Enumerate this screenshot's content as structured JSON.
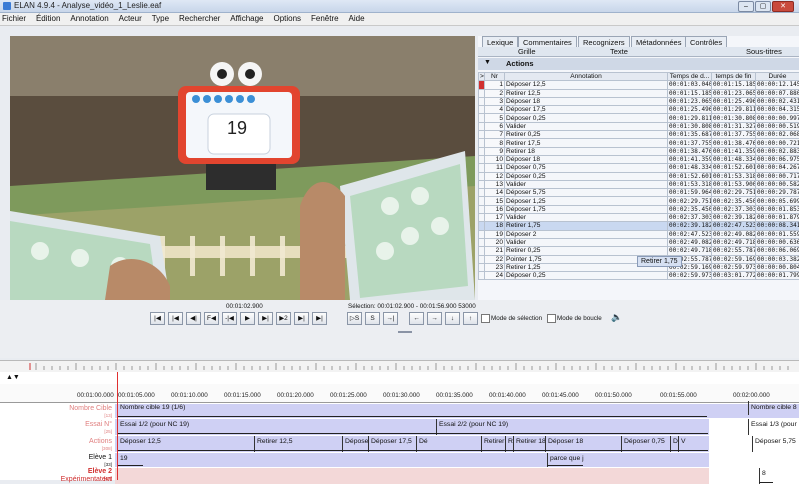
{
  "window": {
    "title": "ELAN 4.9.4 - Analyse_vidéo_1_Leslie.eaf",
    "controls": [
      "–",
      "▢",
      "✕"
    ]
  },
  "menu": [
    "Fichier",
    "Édition",
    "Annotation",
    "Acteur",
    "Type",
    "Rechercher",
    "Affichage",
    "Options",
    "Fenêtre",
    "Aide"
  ],
  "video": {
    "display_number": "19"
  },
  "tabs": [
    "Lexique",
    "Commentaires",
    "Recognizers",
    "Métadonnées",
    "Contrôles"
  ],
  "subtabs": [
    "Grille",
    "Texte",
    "Sous-titres"
  ],
  "grid": {
    "tier": "Actions",
    "columns": [
      "Nr",
      "Annotation",
      "Temps de d...",
      "temps de fin",
      "Durée"
    ],
    "rows": [
      [
        "1",
        "Déposer 12,5",
        "00:01:03.040",
        "00:01:15.185",
        "00:00:12.145"
      ],
      [
        "2",
        "Retirer 12,5",
        "00:01:15.185",
        "00:01:23.065",
        "00:00:07.880"
      ],
      [
        "3",
        "Déposer 18",
        "00:01:23.065",
        "00:01:25.496",
        "00:00:02.431"
      ],
      [
        "4",
        "Déposer 17,5",
        "00:01:25.496",
        "00:01:29.811",
        "00:00:04.315"
      ],
      [
        "5",
        "Déposer 0,25",
        "00:01:29.811",
        "00:01:30.808",
        "00:00:00.997"
      ],
      [
        "6",
        "Valider",
        "00:01:30.808",
        "00:01:31.327",
        "00:00:00.519"
      ],
      [
        "7",
        "Retirer 0,25",
        "00:01:35.687",
        "00:01:37.755",
        "00:00:02.068"
      ],
      [
        "8",
        "Retirer 17,5",
        "00:01:37.755",
        "00:01:38.476",
        "00:00:00.721"
      ],
      [
        "9",
        "Retirer 18",
        "00:01:38.476",
        "00:01:41.359",
        "00:00:02.883"
      ],
      [
        "10",
        "Déposer 18",
        "00:01:41.359",
        "00:01:48.334",
        "00:00:06.975"
      ],
      [
        "11",
        "Déposer 0,75",
        "00:01:48.334",
        "00:01:52.601",
        "00:00:04.267"
      ],
      [
        "12",
        "Déposer 0,25",
        "00:01:52.601",
        "00:01:53.318",
        "00:00:00.717"
      ],
      [
        "13",
        "Valider",
        "00:01:53.318",
        "00:01:53.900",
        "00:00:00.582"
      ],
      [
        "14",
        "Déposer 5,75",
        "00:01:59.964",
        "00:02:29.751",
        "00:00:29.787"
      ],
      [
        "15",
        "Déposer 1,25",
        "00:02:29.751",
        "00:02:35.450",
        "00:00:05.699"
      ],
      [
        "16",
        "Déposer 1,75",
        "00:02:35.450",
        "00:02:37.303",
        "00:00:01.853"
      ],
      [
        "17",
        "Valider",
        "00:02:37.303",
        "00:02:39.182",
        "00:00:01.879"
      ],
      [
        "18",
        "Retirer 1,75",
        "00:02:39.182",
        "00:02:47.523",
        "00:00:08.341"
      ],
      [
        "19",
        "Déposer 2",
        "00:02:47.523",
        "00:02:49.082",
        "00:00:01.559"
      ],
      [
        "20",
        "Valider",
        "00:02:49.082",
        "00:02:49.718",
        "00:00:00.636"
      ],
      [
        "21",
        "Retirer 0,25",
        "00:02:49.718",
        "00:02:55.787",
        "00:00:06.069"
      ],
      [
        "22",
        "Pointer 1,75",
        "00:02:55.787",
        "00:02:59.169",
        "00:00:03.382"
      ],
      [
        "23",
        "Retirer 1,25",
        "00:02:59.169",
        "00:02:59.973",
        "00:00:00.804"
      ],
      [
        "24",
        "Déposer 0,25",
        "00:02:59.973",
        "00:03:01.772",
        "00:00:01.799"
      ]
    ],
    "tooltip": "Retirer 1,75"
  },
  "player": {
    "time": "00:01:02.900",
    "selection": "Sélection: 00:01:02.900 - 00:01:56.900  53000",
    "buttons": [
      "|◀",
      "|◀",
      "◀|",
      "F◀",
      "-|◀",
      "▶",
      "▶|",
      "▶2",
      "▶|",
      "▶|"
    ],
    "sel_buttons": [
      "▷S",
      "S",
      "→|"
    ],
    "nav_buttons": [
      "←",
      "→",
      "↓",
      "↑"
    ],
    "selection_mode": "Mode de sélection",
    "loop_mode": "Mode de boucle",
    "volume_icon": "speaker-icon"
  },
  "timeline": {
    "start": "00:01:00.000",
    "ticks": [
      "00:01:05.000",
      "00:01:10.000",
      "00:01:15.000",
      "00:01:20.000",
      "00:01:25.000",
      "00:01:30.000",
      "00:01:35.000",
      "00:01:40.000",
      "00:01:45.000",
      "00:01:50.000",
      "00:01:55.000",
      "00:02:00.000"
    ],
    "tiers": [
      {
        "name": "Nombre Cible",
        "count": "[13]",
        "color": "#e08080"
      },
      {
        "name": "Essai N°",
        "count": "[25]",
        "color": "#e08080"
      },
      {
        "name": "Actions",
        "count": "[308]",
        "color": "#e08080"
      },
      {
        "name": "Elève 1",
        "count": "[33]",
        "color": "#111111"
      },
      {
        "name": "Elève 2",
        "count": "[47]",
        "color": "#d03030"
      },
      {
        "name": "Expérimentateur",
        "count": "[46]",
        "color": "#d03030"
      }
    ],
    "nombre_cible": [
      "Nombre cible 19  (1/6)",
      "Nombre cible 8"
    ],
    "essai": [
      "Essai 1/2 (pour NC 19)",
      "Essai 2/2 (pour NC 19)",
      "Essai 1/3 (pour"
    ],
    "actions": [
      "Déposer 12,5",
      "Retirer 12,5",
      "Dépose",
      "Déposer 17,5",
      "Dé",
      "Retirer",
      "R",
      "Retirer 18",
      "Déposer 18",
      "Déposer 0,75",
      "D",
      "V",
      "Déposer 5,75"
    ],
    "eleve1": [
      "19",
      "parce que j"
    ],
    "eleve2": [
      "8"
    ]
  }
}
